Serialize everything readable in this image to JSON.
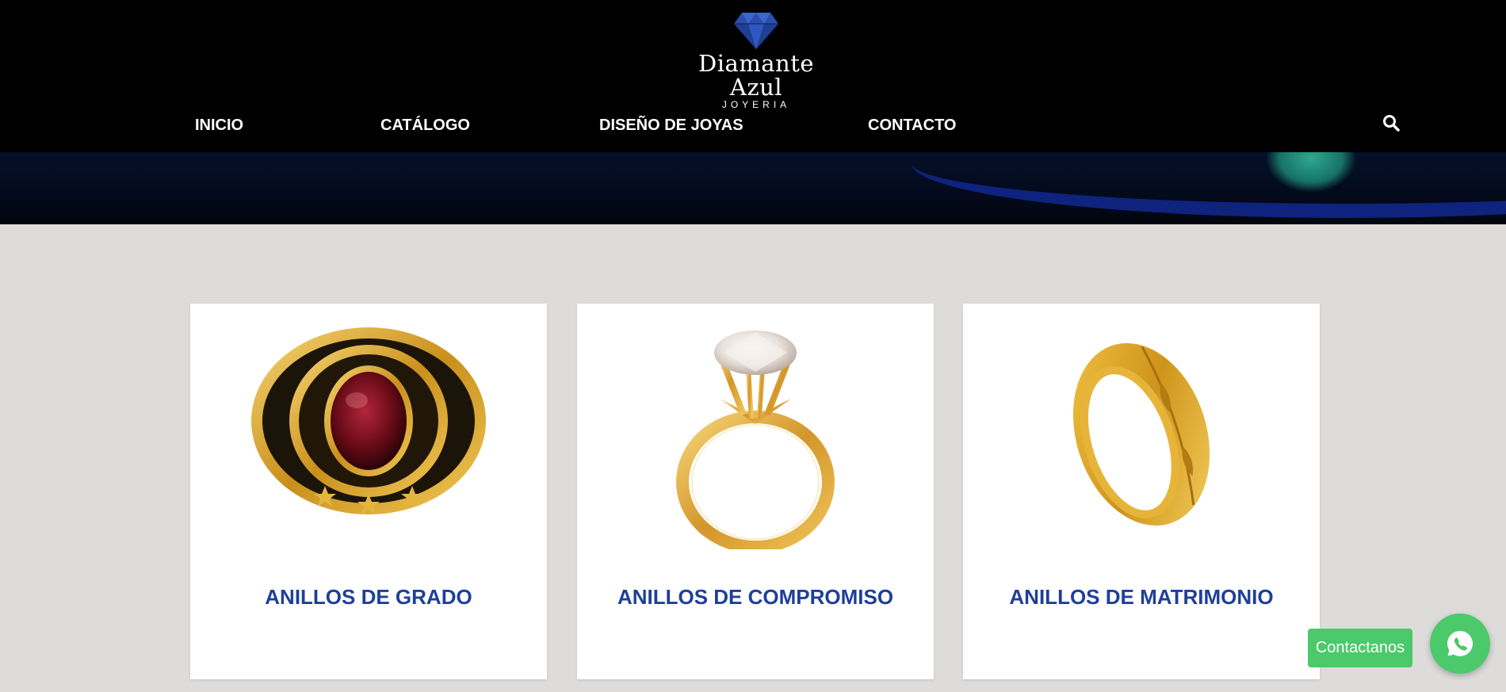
{
  "brand": {
    "name": "Diamante Azul",
    "tagline": "JOYERIA",
    "logo_icon": "diamond-icon",
    "logo_color": "#2a4fb0"
  },
  "nav": {
    "items": [
      {
        "label": "INICIO"
      },
      {
        "label": "CATÁLOGO"
      },
      {
        "label": "DISEÑO DE JOYAS"
      },
      {
        "label": "CONTACTO"
      }
    ],
    "search_icon": "search-icon"
  },
  "categories": [
    {
      "title": "ANILLOS DE GRADO",
      "image": "graduation-ring"
    },
    {
      "title": "ANILLOS DE COMPROMISO",
      "image": "engagement-ring"
    },
    {
      "title": "ANILLOS DE MATRIMONIO",
      "image": "wedding-band"
    }
  ],
  "contact": {
    "label": "Contactanos",
    "icon": "whatsapp-icon",
    "color": "#4cc96a"
  },
  "colors": {
    "title_blue": "#1e3f9a",
    "page_background": "#dddcdb",
    "header_background": "#000000"
  }
}
